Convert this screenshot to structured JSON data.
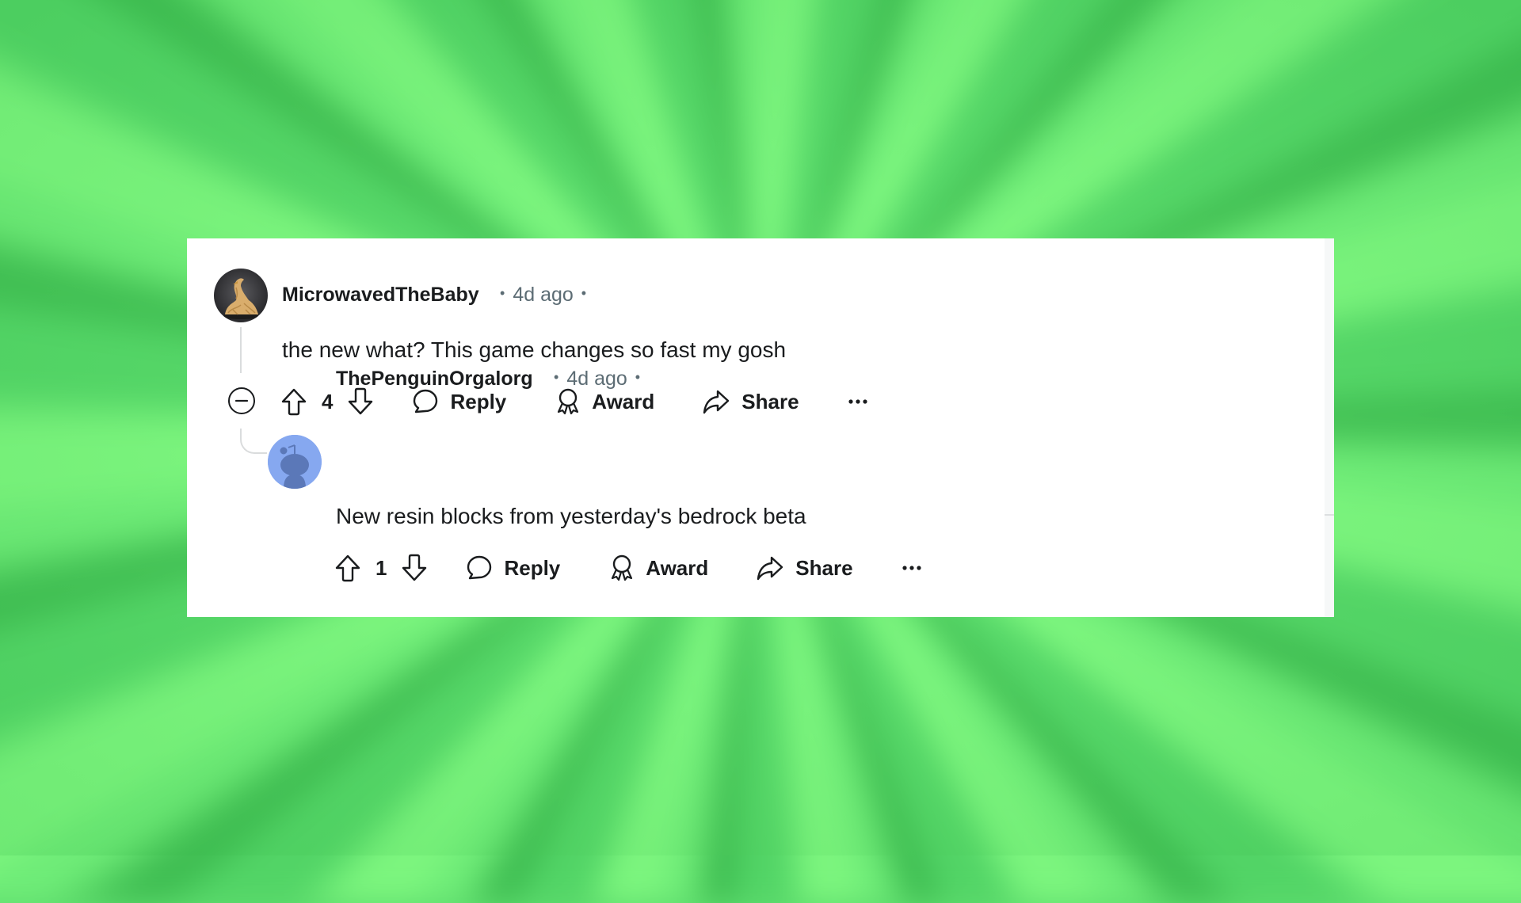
{
  "background": {
    "style": "green sunburst",
    "colors": [
      "#7cf57e",
      "#52d466",
      "#3fbd52"
    ]
  },
  "comments": [
    {
      "username": "MicrowavedTheBaby",
      "separator": "•",
      "timestamp": "4d ago",
      "trailing_separator": "•",
      "avatar": "avatar-noodle-bird",
      "body": "the new what? This game changes so fast my gosh",
      "score": "4",
      "actions": {
        "reply": "Reply",
        "award": "Award",
        "share": "Share",
        "more": "more-options-icon"
      },
      "collapse_icon": "collapse-minus-icon"
    },
    {
      "username": "ThePenguinOrgalorg",
      "separator": "•",
      "timestamp": "4d ago",
      "trailing_separator": "•",
      "avatar": "avatar-default-snoo",
      "body": "New resin blocks from yesterday's bedrock beta",
      "score": "1",
      "actions": {
        "reply": "Reply",
        "award": "Award",
        "share": "Share",
        "more": "more-options-icon"
      }
    }
  ],
  "colors": {
    "text": "#1a1c1e",
    "meta": "#5c6c74",
    "thread_line": "#dadcdd",
    "snoo_bg": "#86a8f0",
    "snoo_fg": "#5b78b8"
  }
}
